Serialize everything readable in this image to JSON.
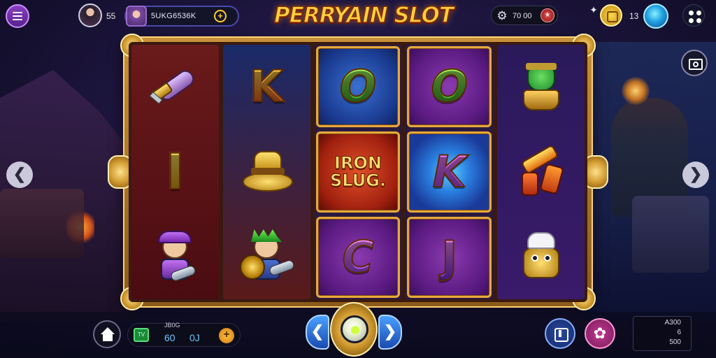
{
  "header": {
    "title": "PERRYAIN SLOT",
    "avatar_count": "55",
    "profile_name": "5UKG6536K",
    "profile_add": "+",
    "settings_value": "70 00",
    "settings_btn": "★",
    "coin_count": "13"
  },
  "reels": [
    [
      "",
      "I",
      ""
    ],
    [
      "K",
      "",
      ""
    ],
    [
      "O",
      "IRON SLUG.",
      "C"
    ],
    [
      "O",
      "K",
      "J"
    ],
    [
      "",
      "",
      ""
    ]
  ],
  "bottom": {
    "tv_label": "TV",
    "bet_label": "JB0G",
    "bet_value_1": "60",
    "bet_value_2": "0J",
    "bet_add": "+",
    "spin_prev": "❮",
    "spin_next": "❯",
    "flower": "✿",
    "info_line_1": "A300",
    "info_line_2": "6",
    "info_line_3": "500"
  },
  "nav": {
    "left_arrow": "❮",
    "right_arrow": "❯"
  },
  "colors": {
    "accent_gold": "#ffd23a",
    "frame": "#c8913a",
    "menu_purple": "#8a3ec0"
  }
}
